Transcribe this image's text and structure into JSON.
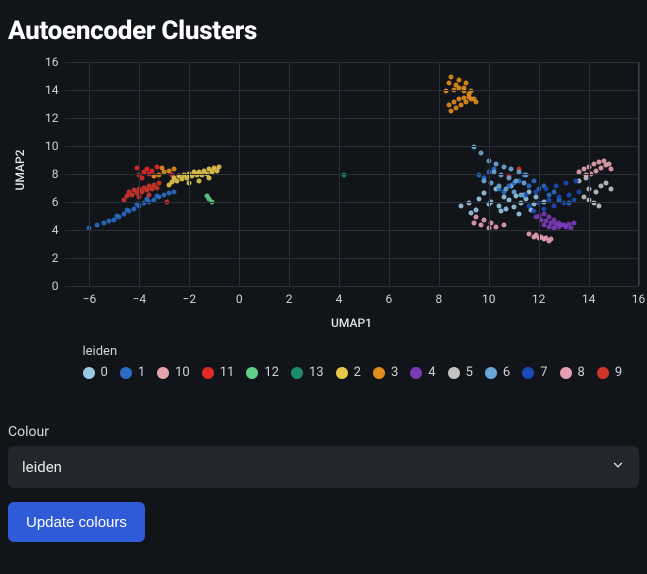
{
  "title": "Autoencoder Clusters",
  "chart_data": {
    "type": "scatter",
    "title": "Autoencoder Clusters",
    "xlabel": "UMAP1",
    "ylabel": "UMAP2",
    "xlim": [
      -7,
      16
    ],
    "ylim": [
      0,
      16
    ],
    "xticks": [
      -6,
      -4,
      -2,
      0,
      2,
      4,
      6,
      8,
      10,
      12,
      14,
      16
    ],
    "yticks": [
      0,
      2,
      4,
      6,
      8,
      10,
      12,
      14,
      16
    ],
    "legend_title": "leiden",
    "series": [
      {
        "name": "0",
        "color": "#9ac7e4",
        "x": [
          9.2,
          9.6,
          10.1,
          10.4,
          10.8,
          11.1,
          11.3,
          10.7,
          11.5,
          11.8,
          12.2,
          9.5,
          10.0,
          10.6,
          11.0,
          11.4,
          10.3,
          10.9,
          11.6,
          11.9,
          9.8,
          10.5,
          11.2,
          11.7,
          8.9,
          9.3
        ],
        "y": [
          6.0,
          6.3,
          6.1,
          5.8,
          6.2,
          6.5,
          6.0,
          5.6,
          6.3,
          5.9,
          6.1,
          5.5,
          5.9,
          6.4,
          5.7,
          6.6,
          7.0,
          7.2,
          6.8,
          6.4,
          6.7,
          5.4,
          5.2,
          5.5,
          5.8,
          5.3
        ]
      },
      {
        "name": "1",
        "color": "#2b6cc4",
        "x": [
          -6.0,
          -5.7,
          -5.4,
          -5.2,
          -5.0,
          -4.8,
          -4.6,
          -4.4,
          -4.2,
          -4.0,
          -3.8,
          -3.6,
          -3.4,
          -3.2,
          -3.0,
          -2.8,
          -2.6,
          -4.9,
          -4.5,
          -4.1,
          -3.7,
          -3.3,
          10.4,
          10.6,
          10.8,
          11.0,
          11.2,
          11.6,
          12.0,
          12.4,
          12.8,
          13.2,
          9.6,
          9.8,
          10.0,
          10.2,
          11.4,
          11.8,
          12.2,
          12.6
        ],
        "y": [
          4.2,
          4.4,
          4.6,
          4.7,
          4.8,
          5.0,
          5.2,
          5.4,
          5.6,
          5.8,
          6.0,
          6.1,
          6.2,
          6.4,
          6.6,
          6.7,
          6.8,
          5.1,
          5.5,
          5.9,
          6.3,
          6.5,
          7.0,
          6.8,
          7.2,
          7.4,
          7.6,
          7.2,
          7.0,
          6.6,
          6.2,
          6.0,
          8.0,
          7.8,
          8.2,
          8.4,
          8.0,
          7.6,
          7.2,
          6.8
        ]
      },
      {
        "name": "10",
        "color": "#e5a3b0",
        "x": [
          13.6,
          13.8,
          14.0,
          14.2,
          14.4,
          14.6,
          14.8,
          14.3,
          14.5,
          14.7,
          14.9,
          13.9,
          14.1
        ],
        "y": [
          8.2,
          8.4,
          8.6,
          8.8,
          8.9,
          9.0,
          8.8,
          8.3,
          8.5,
          8.7,
          8.4,
          8.0,
          8.1
        ]
      },
      {
        "name": "11",
        "color": "#e02a2a",
        "x": [
          -4.0,
          -3.8,
          -3.9,
          -3.6,
          -3.7,
          -3.5,
          -4.1,
          -3.4,
          -3.3,
          -2.9,
          -2.7,
          10.8,
          11.2
        ],
        "y": [
          8.0,
          8.2,
          7.8,
          8.1,
          8.4,
          8.3,
          8.5,
          7.9,
          8.6,
          6.1,
          8.0,
          7.9,
          8.4
        ]
      },
      {
        "name": "12",
        "color": "#5fd08a",
        "x": [
          -1.2,
          -1.1,
          -1.3
        ],
        "y": [
          6.3,
          6.1,
          6.5
        ]
      },
      {
        "name": "13",
        "color": "#1a8b6e",
        "x": [
          4.2
        ],
        "y": [
          8.0
        ]
      },
      {
        "name": "2",
        "color": "#e6c84b",
        "x": [
          -2.6,
          -2.4,
          -2.2,
          -2.0,
          -1.8,
          -1.6,
          -1.4,
          -1.2,
          -1.0,
          -0.8,
          -2.7,
          -2.5,
          -2.3,
          -2.1,
          -1.9,
          -1.7,
          -1.5,
          -1.3,
          -1.1,
          -0.9,
          -2.8,
          -2.0,
          -1.6,
          -1.2
        ],
        "y": [
          7.8,
          7.9,
          8.0,
          8.1,
          8.2,
          8.2,
          8.3,
          8.4,
          8.5,
          8.6,
          7.5,
          7.6,
          7.7,
          7.8,
          7.9,
          8.0,
          8.0,
          8.1,
          8.2,
          8.3,
          7.3,
          7.4,
          7.6,
          7.8
        ]
      },
      {
        "name": "3",
        "color": "#e28c1c",
        "x": [
          8.4,
          8.6,
          8.8,
          9.0,
          9.2,
          9.4,
          8.5,
          8.7,
          8.9,
          9.1,
          9.3,
          9.5,
          8.3,
          8.6,
          8.8,
          9.0,
          9.2,
          8.4,
          8.7,
          9.0,
          9.3,
          8.5,
          8.8,
          9.1,
          -3.0,
          -2.8,
          -2.6,
          -3.2,
          -3.4,
          -3.1
        ],
        "y": [
          13.0,
          13.2,
          13.4,
          13.5,
          13.6,
          13.4,
          12.6,
          12.8,
          13.0,
          13.2,
          13.4,
          13.2,
          14.0,
          14.1,
          14.2,
          14.0,
          13.8,
          14.6,
          14.4,
          14.2,
          14.0,
          15.0,
          14.8,
          14.6,
          8.2,
          8.3,
          8.4,
          8.0,
          7.9,
          8.5
        ]
      },
      {
        "name": "4",
        "color": "#7a3ab8",
        "x": [
          12.2,
          12.4,
          12.6,
          12.8,
          13.0,
          13.2,
          13.4,
          12.1,
          12.3,
          12.5,
          12.7,
          12.9,
          13.1,
          13.3,
          11.9,
          12.0,
          12.2,
          12.4,
          12.6,
          12.8,
          13.0
        ],
        "y": [
          4.4,
          4.3,
          4.2,
          4.3,
          4.4,
          4.5,
          4.6,
          4.8,
          4.7,
          4.6,
          4.5,
          4.4,
          4.3,
          4.2,
          5.0,
          5.1,
          5.2,
          5.0,
          4.8,
          4.6,
          4.4
        ]
      },
      {
        "name": "5",
        "color": "#c3c3c3",
        "x": [
          13.8,
          14.0,
          14.2,
          14.4,
          14.0,
          14.3,
          14.5,
          14.7,
          14.9,
          13.6,
          13.9
        ],
        "y": [
          6.4,
          6.2,
          6.0,
          5.8,
          7.0,
          6.8,
          7.2,
          7.4,
          7.0,
          7.6,
          7.8
        ]
      },
      {
        "name": "6",
        "color": "#6aa7d6",
        "x": [
          10.0,
          10.3,
          10.6,
          10.9,
          11.2,
          11.5,
          10.2,
          10.5,
          10.8,
          11.1,
          11.4,
          9.8,
          10.1,
          10.4,
          10.7,
          11.0,
          11.3,
          9.4,
          9.7
        ],
        "y": [
          9.0,
          8.8,
          8.6,
          8.4,
          8.2,
          8.0,
          8.2,
          8.0,
          7.8,
          7.6,
          7.4,
          7.6,
          7.4,
          7.2,
          7.0,
          6.8,
          6.6,
          10.0,
          9.6
        ]
      },
      {
        "name": "7",
        "color": "#1a4bb5",
        "x": [
          11.6,
          12.0,
          12.4,
          12.8,
          13.2,
          13.6,
          11.8,
          12.2,
          12.6,
          13.0,
          13.4,
          11.5,
          11.9,
          12.3,
          12.7,
          13.1,
          13.5
        ],
        "y": [
          5.8,
          6.0,
          6.2,
          6.4,
          6.6,
          6.8,
          5.4,
          5.6,
          5.8,
          6.0,
          6.2,
          6.6,
          6.8,
          7.0,
          7.2,
          7.4,
          7.6
        ]
      },
      {
        "name": "8",
        "color": "#e79fb3",
        "x": [
          9.4,
          9.7,
          10.0,
          10.3,
          10.6,
          9.5,
          9.8,
          10.1,
          11.8,
          12.0,
          12.2,
          12.4,
          11.6,
          11.9,
          12.1,
          12.3,
          12.5
        ],
        "y": [
          4.6,
          4.4,
          4.2,
          4.3,
          4.4,
          5.0,
          4.8,
          4.6,
          3.6,
          3.5,
          3.4,
          3.3,
          3.8,
          3.7,
          3.6,
          3.5,
          3.4
        ]
      },
      {
        "name": "9",
        "color": "#d0342b",
        "x": [
          -4.4,
          -4.2,
          -4.0,
          -3.8,
          -3.6,
          -3.4,
          -3.2,
          -4.5,
          -4.3,
          -4.1,
          -3.9,
          -3.7,
          -3.5,
          -3.3,
          -4.6,
          -4.0,
          -3.6
        ],
        "y": [
          6.8,
          6.9,
          7.0,
          7.1,
          7.2,
          7.3,
          7.4,
          6.5,
          6.6,
          6.7,
          6.8,
          6.9,
          7.0,
          7.1,
          6.2,
          6.4,
          6.6
        ]
      }
    ]
  },
  "controls": {
    "colour_label": "Colour",
    "colour_value": "leiden",
    "update_button_label": "Update colours"
  }
}
